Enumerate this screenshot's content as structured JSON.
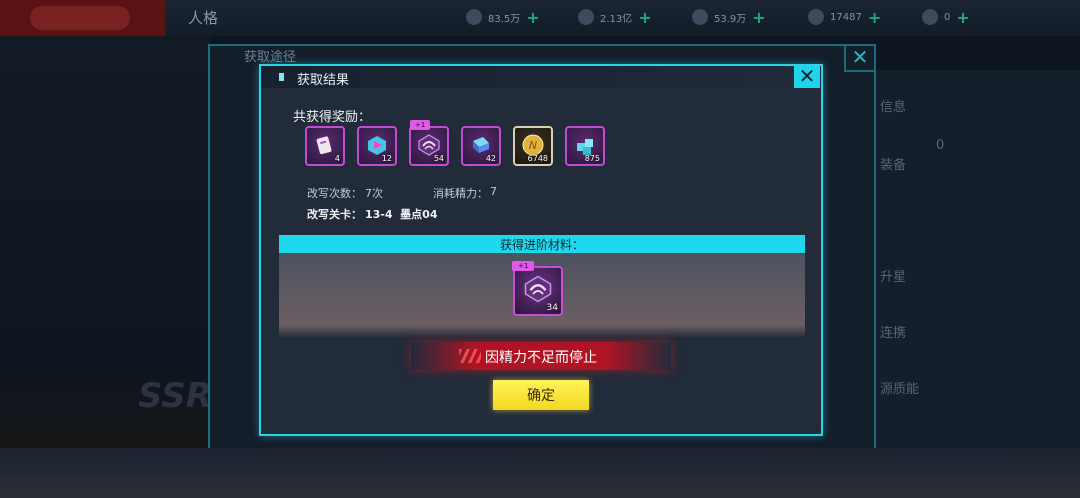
{
  "background": {
    "window_title": "人格",
    "resources": [
      {
        "icon": "energy-icon",
        "value": "83.5万"
      },
      {
        "icon": "coin-icon",
        "value": "2.13亿"
      },
      {
        "icon": "hand-icon",
        "value": "53.9万"
      },
      {
        "icon": "ticket-icon",
        "value": "17487"
      },
      {
        "icon": "flame-icon",
        "value": "0"
      }
    ],
    "outer_dialog_title": "获取途径",
    "side_menu": [
      "信息",
      "装备",
      "升星",
      "连携",
      "源质能"
    ],
    "side_count": "0",
    "rarity": "SSR"
  },
  "modal": {
    "title": "获取结果",
    "total_label": "共获得奖励：",
    "rewards": [
      {
        "icon": "ticket-item-icon",
        "count": "4",
        "tag": ""
      },
      {
        "icon": "cube-chip-icon",
        "count": "12",
        "tag": ""
      },
      {
        "icon": "advance-core-icon",
        "count": "54",
        "tag": "+1"
      },
      {
        "icon": "crystal-box-icon",
        "count": "42",
        "tag": ""
      },
      {
        "icon": "gold-coin-icon",
        "count": "6748",
        "tag": ""
      },
      {
        "icon": "blue-cubes-icon",
        "count": "875",
        "tag": ""
      }
    ],
    "rewrite_count_label": "改写次数：",
    "rewrite_count": "7次",
    "stamina_label": "消耗精力：",
    "stamina_value": "7",
    "stage_label": "改写关卡：",
    "stage_value": "13-4  墨点04",
    "advance_label": "获得进阶材料：",
    "advance_item": {
      "icon": "advance-core-icon",
      "count": "34",
      "tag": "+1"
    },
    "warning": "因精力不足而停止",
    "confirm_label": "确定"
  },
  "colors": {
    "accent": "#2ad3e6",
    "confirm": "#f2e02a",
    "warning": "#b01424",
    "rarity_frame": "#c24bd6"
  }
}
